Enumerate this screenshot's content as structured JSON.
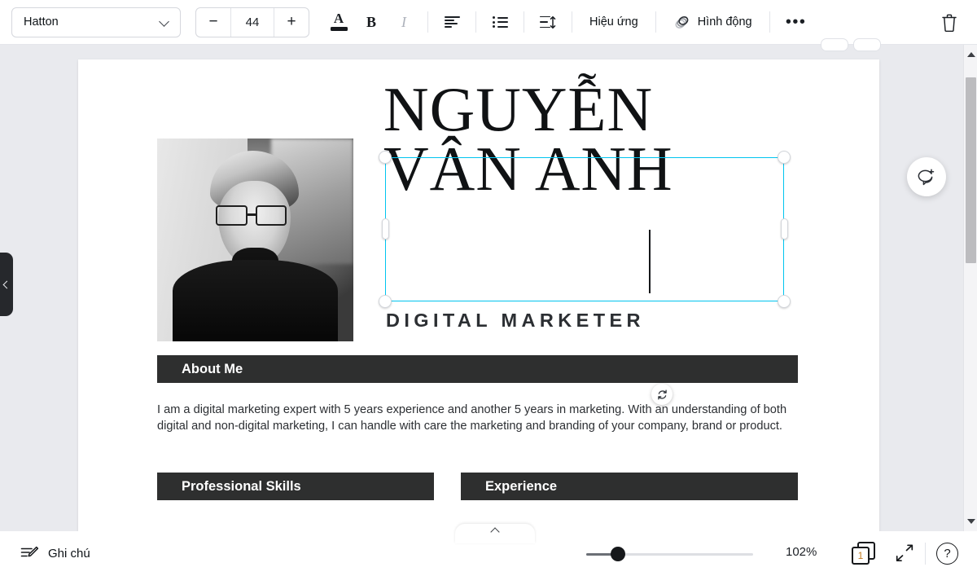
{
  "toolbar": {
    "font_name": "Hatton",
    "font_size": "44",
    "decrease_label": "−",
    "increase_label": "+",
    "text_color_label": "A",
    "bold_label": "B",
    "italic_label": "I",
    "effects_label": "Hiệu ứng",
    "animate_label": "Hình động",
    "more_label": "•••",
    "icons": {
      "chevron": "chevron-down-icon",
      "align": "text-align-icon",
      "list": "bullet-list-icon",
      "spacing": "line-spacing-icon",
      "animate": "animation-icon",
      "more": "more-options-icon",
      "delete": "trash-icon"
    }
  },
  "canvas": {
    "photo_alt": "portrait-photo-black-and-white",
    "headline_line1": "NGUYỄN",
    "headline_line2": "VÂN ANH",
    "subheadline": "DIGITAL MARKETER",
    "sections": [
      {
        "title": "About Me"
      },
      {
        "title": "Professional Skills"
      },
      {
        "title": "Experience"
      }
    ],
    "about_text": "I am a digital marketing expert with 5 years experience and another 5 years in marketing. With an understanding of both digital and non-digital marketing, I can handle with care the marketing and branding of your company, brand or product.",
    "selection": {
      "active": true,
      "color": "#00c4ef",
      "rotate_icon": "rotate-icon"
    }
  },
  "side": {
    "collapse_icon": "chevron-left-icon",
    "comment_icon": "add-comment-icon"
  },
  "bottombar": {
    "notes_label": "Ghi chú",
    "notes_icon": "notes-pencil-icon",
    "zoom_value": "102%",
    "page_number": "1",
    "pages_icon": "pages-icon",
    "expand_icon": "fullscreen-icon",
    "help_label": "?",
    "panel_toggle_icon": "chevron-up-icon"
  },
  "colors": {
    "accent_selection": "#00c4ef",
    "section_bar": "#2e2f2f",
    "editor_bg": "#e9eaee",
    "page_bg": "#ffffff",
    "page_number_color": "#c27a20"
  }
}
